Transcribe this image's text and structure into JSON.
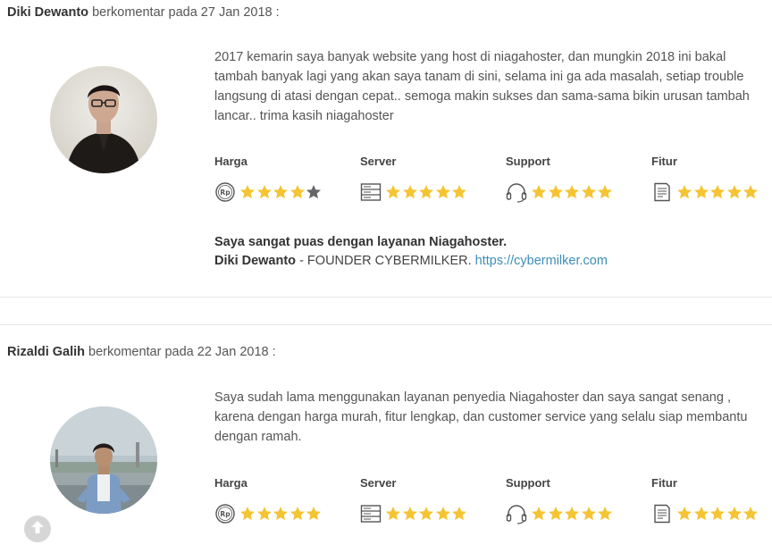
{
  "reviews": [
    {
      "author": "Diki Dewanto",
      "meta": " berkomentar pada 27 Jan 2018 :",
      "comment": "2017 kemarin saya banyak website yang host di niagahoster, dan mungkin 2018 ini bakal tambah banyak lagi yang akan saya tanam di sini, selama ini ga ada masalah, setiap trouble langsung di atasi dengan cepat.. semoga makin sukses dan sama-sama bikin urusan tambah lancar.. trima kasih niagahoster",
      "ratings": [
        {
          "label": "Harga",
          "icon": "price-tag-icon",
          "stars": 4
        },
        {
          "label": "Server",
          "icon": "server-icon",
          "stars": 5
        },
        {
          "label": "Support",
          "icon": "headset-icon",
          "stars": 5
        },
        {
          "label": "Fitur",
          "icon": "document-icon",
          "stars": 5
        }
      ],
      "summary_title": "Saya sangat puas dengan layanan Niagahoster.",
      "summary_name": "Diki Dewanto",
      "summary_role": " - FOUNDER CYBERMILKER. ",
      "summary_link": "https://cybermilker.com"
    },
    {
      "author": "Rizaldi Galih",
      "meta": " berkomentar pada 22 Jan 2018 :",
      "comment": "Saya sudah lama menggunakan layanan penyedia Niagahoster dan saya sangat senang , karena dengan harga murah, fitur lengkap, dan customer service yang selalu siap membantu dengan ramah.",
      "ratings": [
        {
          "label": "Harga",
          "icon": "price-tag-icon",
          "stars": 5
        },
        {
          "label": "Server",
          "icon": "server-icon",
          "stars": 5
        },
        {
          "label": "Support",
          "icon": "headset-icon",
          "stars": 5
        },
        {
          "label": "Fitur",
          "icon": "document-icon",
          "stars": 5
        }
      ]
    }
  ],
  "rating_max": 5,
  "colors": {
    "star_filled": "#f5c433",
    "star_empty": "#666666",
    "link": "#3d8eb9",
    "divider": "#e6e6e6"
  },
  "scroll_button": {
    "icon": "arrow-up-icon"
  }
}
